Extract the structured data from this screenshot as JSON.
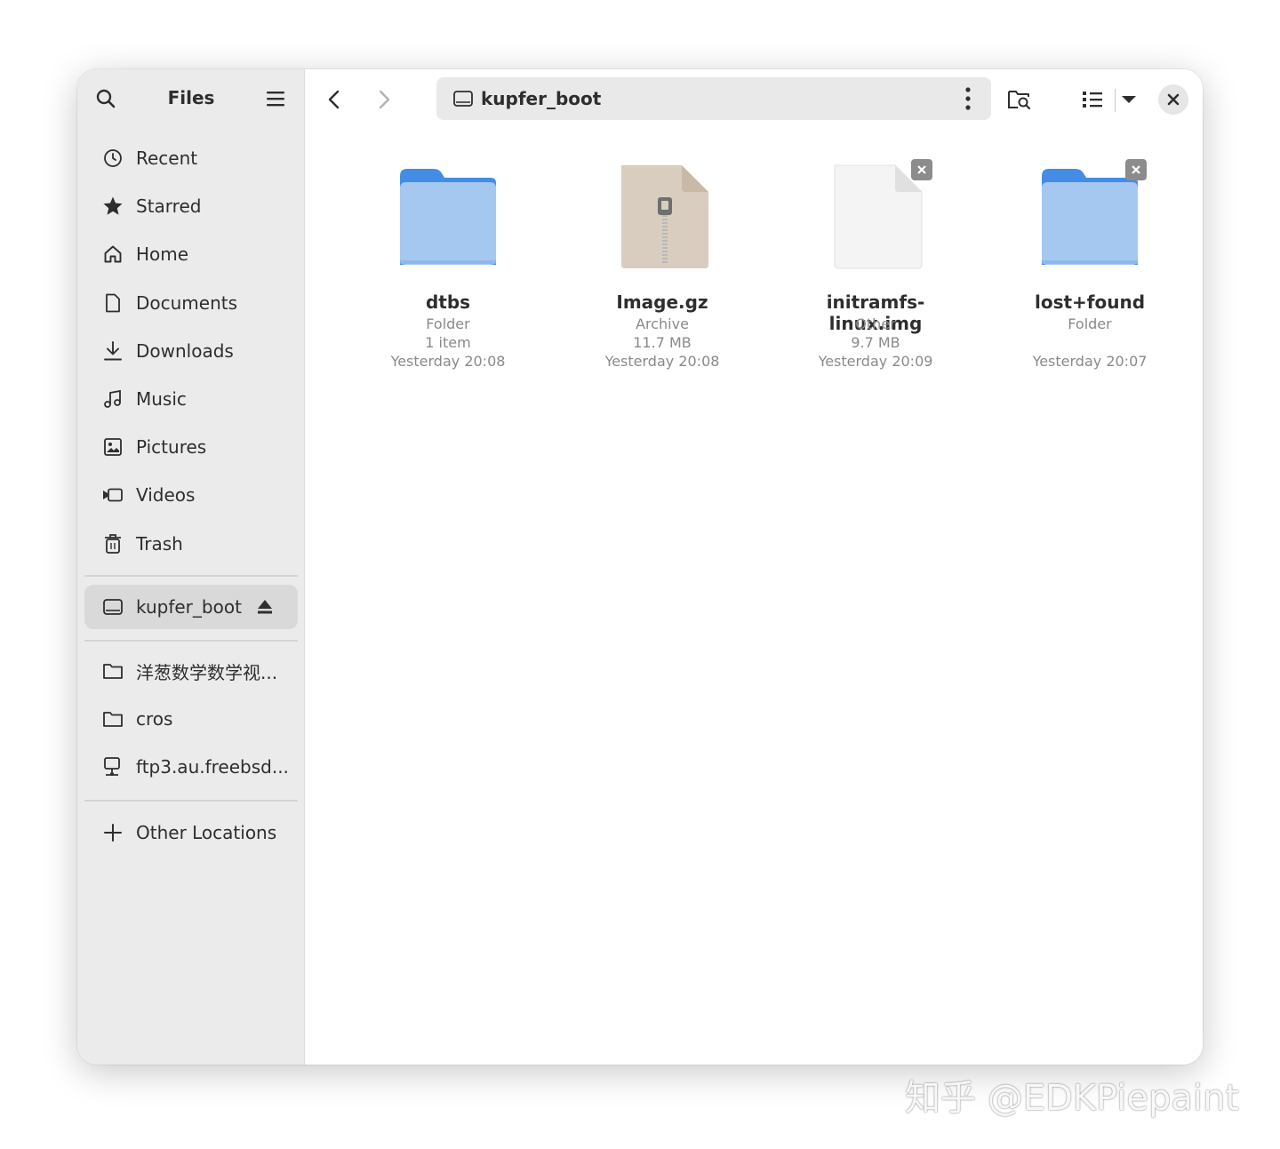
{
  "sidebar": {
    "title": "Files",
    "places": [
      {
        "label": "Recent",
        "icon": "clock-icon"
      },
      {
        "label": "Starred",
        "icon": "star-icon"
      },
      {
        "label": "Home",
        "icon": "home-icon"
      },
      {
        "label": "Documents",
        "icon": "document-icon"
      },
      {
        "label": "Downloads",
        "icon": "download-icon"
      },
      {
        "label": "Music",
        "icon": "music-icon"
      },
      {
        "label": "Pictures",
        "icon": "picture-icon"
      },
      {
        "label": "Videos",
        "icon": "video-icon"
      },
      {
        "label": "Trash",
        "icon": "trash-icon"
      }
    ],
    "device": {
      "label": "kupfer_boot",
      "icon": "drive-icon"
    },
    "bookmarks": [
      {
        "label": "洋葱数学数学视...",
        "icon": "folder-icon"
      },
      {
        "label": "cros",
        "icon": "folder-icon"
      },
      {
        "label": "ftp3.au.freebsd...",
        "icon": "network-icon"
      }
    ],
    "other": {
      "label": "Other Locations",
      "icon": "plus-icon"
    }
  },
  "pathbar": {
    "label": "kupfer_boot"
  },
  "files": [
    {
      "name": "dtbs",
      "type": "Folder",
      "detail": "1 item",
      "modified": "Yesterday 20:08",
      "icon": "folder-icon"
    },
    {
      "name": "Image.gz",
      "type": "Archive",
      "detail": "11.7 MB",
      "modified": "Yesterday 20:08",
      "icon": "archive-icon"
    },
    {
      "name": "initramfs-linux.img",
      "type": "Other",
      "detail": "9.7 MB",
      "modified": "Yesterday 20:09",
      "icon": "file-icon"
    },
    {
      "name": "lost+found",
      "type": "Folder",
      "detail": "",
      "modified": "Yesterday 20:07",
      "icon": "folder-icon"
    }
  ],
  "watermark": "知乎 @EDKPiepaint",
  "colors": {
    "sidebar_bg": "#ebebeb",
    "active_bg": "#d9d9d9",
    "folder_front": "#a4c8f0",
    "folder_back": "#438de6"
  }
}
